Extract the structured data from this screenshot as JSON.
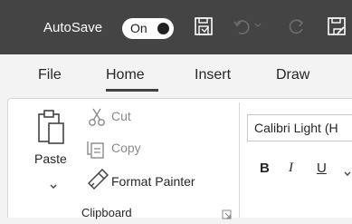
{
  "titlebar": {
    "autosave_label": "AutoSave",
    "autosave_state": "On",
    "icons": [
      "save-icon",
      "undo-icon",
      "redo-icon",
      "save-edit-icon"
    ]
  },
  "tabs": [
    {
      "label": "File",
      "active": false
    },
    {
      "label": "Home",
      "active": true
    },
    {
      "label": "Insert",
      "active": false
    },
    {
      "label": "Draw",
      "active": false
    }
  ],
  "clipboard": {
    "paste_label": "Paste",
    "cut_label": "Cut",
    "copy_label": "Copy",
    "format_painter_label": "Format Painter",
    "group_label": "Clipboard"
  },
  "font": {
    "font_name": "Calibri Light (H",
    "bold_label": "B",
    "italic_label": "I",
    "underline_label": "U"
  },
  "colors": {
    "titlebar": "#444444",
    "ribbon": "#ffffff",
    "tab_area": "#f3f3f3",
    "disabled_text": "#8a8a8a"
  }
}
